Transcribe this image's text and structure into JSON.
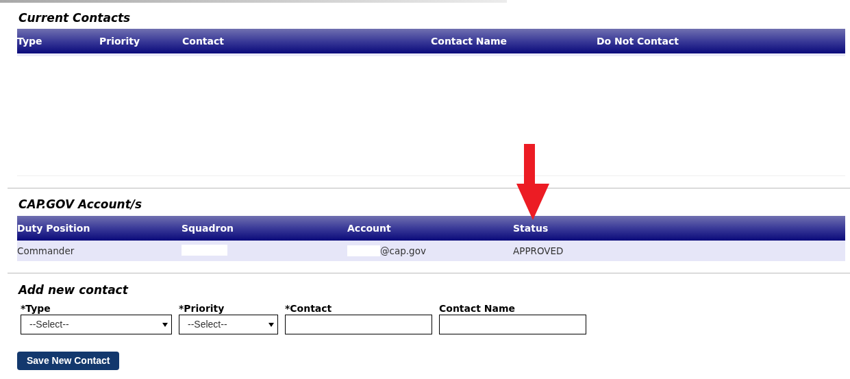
{
  "current_contacts": {
    "title": "Current Contacts",
    "columns": [
      "Type",
      "Priority",
      "Contact",
      "Contact Name",
      "Do Not Contact"
    ]
  },
  "accounts": {
    "title": "CAP.GOV Account/s",
    "columns": [
      "Duty Position",
      "Squadron",
      "Account",
      "Status"
    ],
    "rows": [
      {
        "cells": [
          {
            "kind": "text",
            "text": "Commander"
          },
          {
            "kind": "redacted"
          },
          {
            "kind": "redacted_text",
            "text": "@cap.gov"
          },
          {
            "kind": "text",
            "text": "APPROVED"
          }
        ]
      }
    ]
  },
  "add_contact": {
    "title": "Add new contact",
    "fields": [
      {
        "kind": "select",
        "label": "*Type",
        "value": "--Select--"
      },
      {
        "kind": "select",
        "label": "*Priority",
        "value": "--Select--"
      },
      {
        "kind": "input",
        "label": "*Contact"
      },
      {
        "kind": "input",
        "label": "Contact Name"
      }
    ],
    "button": "Save New Contact"
  }
}
